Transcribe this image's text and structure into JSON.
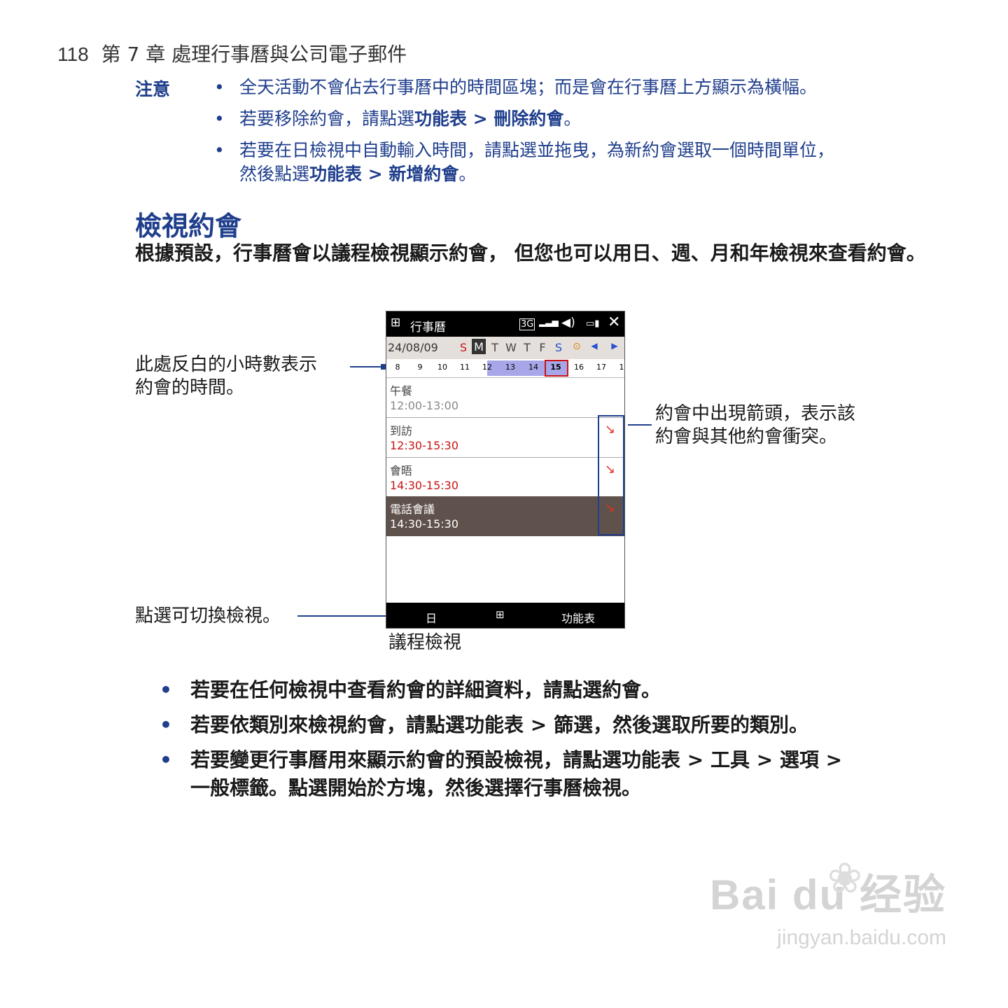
{
  "header": {
    "page_number": "118",
    "chapter": "第 7 章  處理行事曆與公司電子郵件"
  },
  "note": {
    "label": "注意",
    "item1": "全天活動不會佔去行事曆中的時間區塊；而是會在行事曆上方顯示為橫幅。",
    "item2_pre": "若要移除約會，請點選",
    "item2_bold": "功能表 > 刪除約會",
    "item2_post": "。",
    "item3_line1": "若要在日檢視中自動輸入時間，請點選並拖曳，為新約會選取一個時間單位，",
    "item3_pre": "然後點選",
    "item3_bold": "功能表 > 新增約會",
    "item3_post": "。"
  },
  "section_title": "檢視約會",
  "intro": "根據預設，行事曆會以議程檢視顯示約會， 但您也可以用日、週、月和年檢視來查看約會。",
  "callouts": {
    "hours_line1": "此處反白的小時數表示",
    "hours_line2": "約會的時間。",
    "conflict_line1": "約會中出現箭頭，表示該",
    "conflict_line2": "約會與其他約會衝突。",
    "switch": "點選可切換檢視。",
    "caption": "議程檢視"
  },
  "phone": {
    "title": "行事曆",
    "date": "24/08/09",
    "weekdays": [
      "S",
      "M",
      "T",
      "W",
      "T",
      "F",
      "S"
    ],
    "hours": [
      "8",
      "9",
      "10",
      "11",
      "12",
      "13",
      "14",
      "15",
      "16",
      "17",
      "1"
    ],
    "appointments": [
      {
        "name": "午餐",
        "time": "12:00-13:00",
        "conflict": false
      },
      {
        "name": "到訪",
        "time": "12:30-15:30",
        "conflict": true
      },
      {
        "name": "會晤",
        "time": "14:30-15:30",
        "conflict": true
      },
      {
        "name": "電話會議",
        "time": "14:30-15:30",
        "conflict": true
      }
    ],
    "softkey_left": "日",
    "softkey_right": "功能表",
    "colors": {
      "highlight": "#a7a6e8",
      "selected_row": "#5f514b",
      "red": "#c81414",
      "accent": "#1f3e8c"
    }
  },
  "bullets": {
    "b1": "若要在任何檢視中查看約會的詳細資料，請點選約會。",
    "b2_pre": "若要依類別來檢視約會，請點選",
    "b2_bold": "功能表 > 篩選",
    "b2_post": "，然後選取所要的類別。",
    "b3_pre": "若要變更行事曆用來顯示約會的預設檢視，請點選",
    "b3_bold": "功能表 > 工具 > 選項 >",
    "b3_l2_bold1": "一般",
    "b3_l2_bold2": "標籤。點選",
    "b3_l2_bold3": "開始於",
    "b3_l2_post": "方塊，然後選擇行事曆檢視。"
  },
  "watermark": {
    "brand": "Bai du 经验",
    "url": "jingyan.baidu.com"
  }
}
